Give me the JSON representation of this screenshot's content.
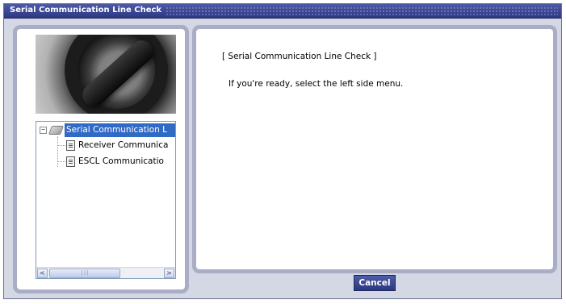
{
  "window": {
    "title": "Serial Communication Line Check"
  },
  "tree": {
    "root": {
      "label": "Serial Communication L",
      "expander": "⊟",
      "icon": "folder-icon"
    },
    "items": [
      {
        "label": "Receiver Communica",
        "icon": "document-icon"
      },
      {
        "label": "ESCL Communicatio",
        "icon": "document-icon"
      }
    ],
    "scrollbar": {
      "left_arrow": "<",
      "right_arrow": ">",
      "thumb_grip": "|||"
    }
  },
  "content": {
    "heading": "[ Serial Communication Line Check ]",
    "message": "If you're ready, select the left side menu."
  },
  "footer": {
    "cancel_label": "Cancel"
  },
  "colors": {
    "title_bar": "#2d3883",
    "selection": "#316ac5",
    "panel_border": "#a9aec6",
    "button": "#3a4790"
  }
}
